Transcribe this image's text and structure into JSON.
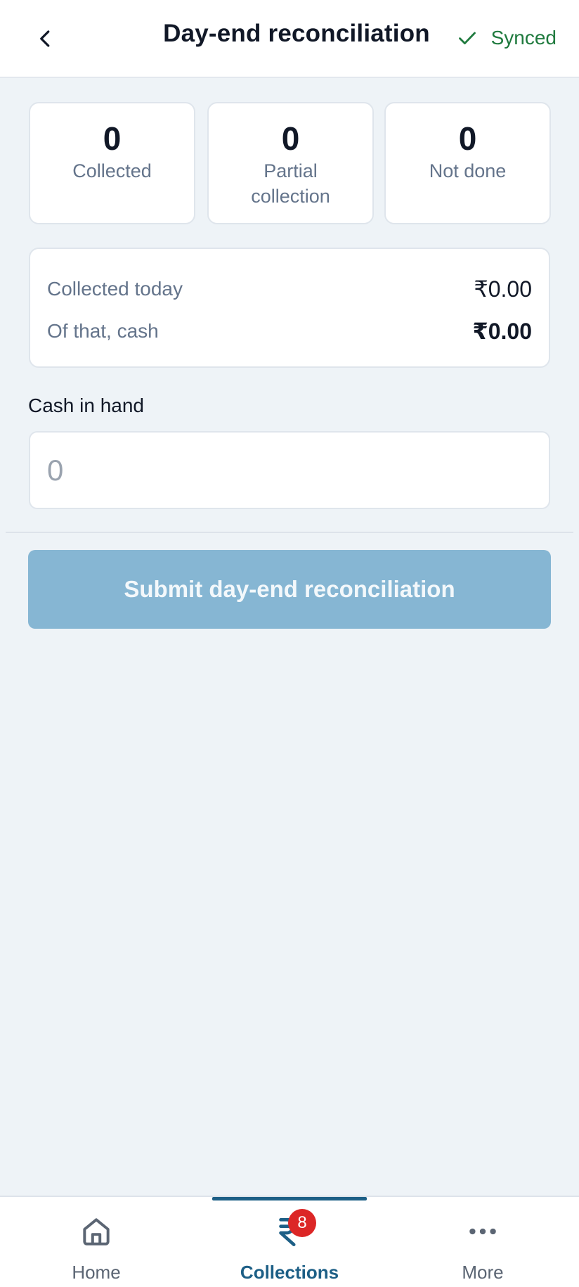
{
  "header": {
    "title": "Day-end reconciliation",
    "sync_status": "Synced"
  },
  "stats": [
    {
      "value": "0",
      "label": "Collected"
    },
    {
      "value": "0",
      "label": "Partial collection"
    },
    {
      "value": "0",
      "label": "Not done"
    }
  ],
  "summary": {
    "collected_today_label": "Collected today",
    "collected_today_value": "₹0.00",
    "cash_label": "Of that, cash",
    "cash_value": "₹0.00"
  },
  "cash_in_hand": {
    "label": "Cash in hand",
    "placeholder": "0"
  },
  "submit_label": "Submit day-end reconciliation",
  "nav": {
    "items": [
      {
        "label": "Home"
      },
      {
        "label": "Collections",
        "badge": "8"
      },
      {
        "label": "More"
      }
    ]
  },
  "colors": {
    "accent": "#1d5f86",
    "submit_disabled": "#86b6d3",
    "synced": "#1f7a3e",
    "badge": "#dc2626"
  }
}
